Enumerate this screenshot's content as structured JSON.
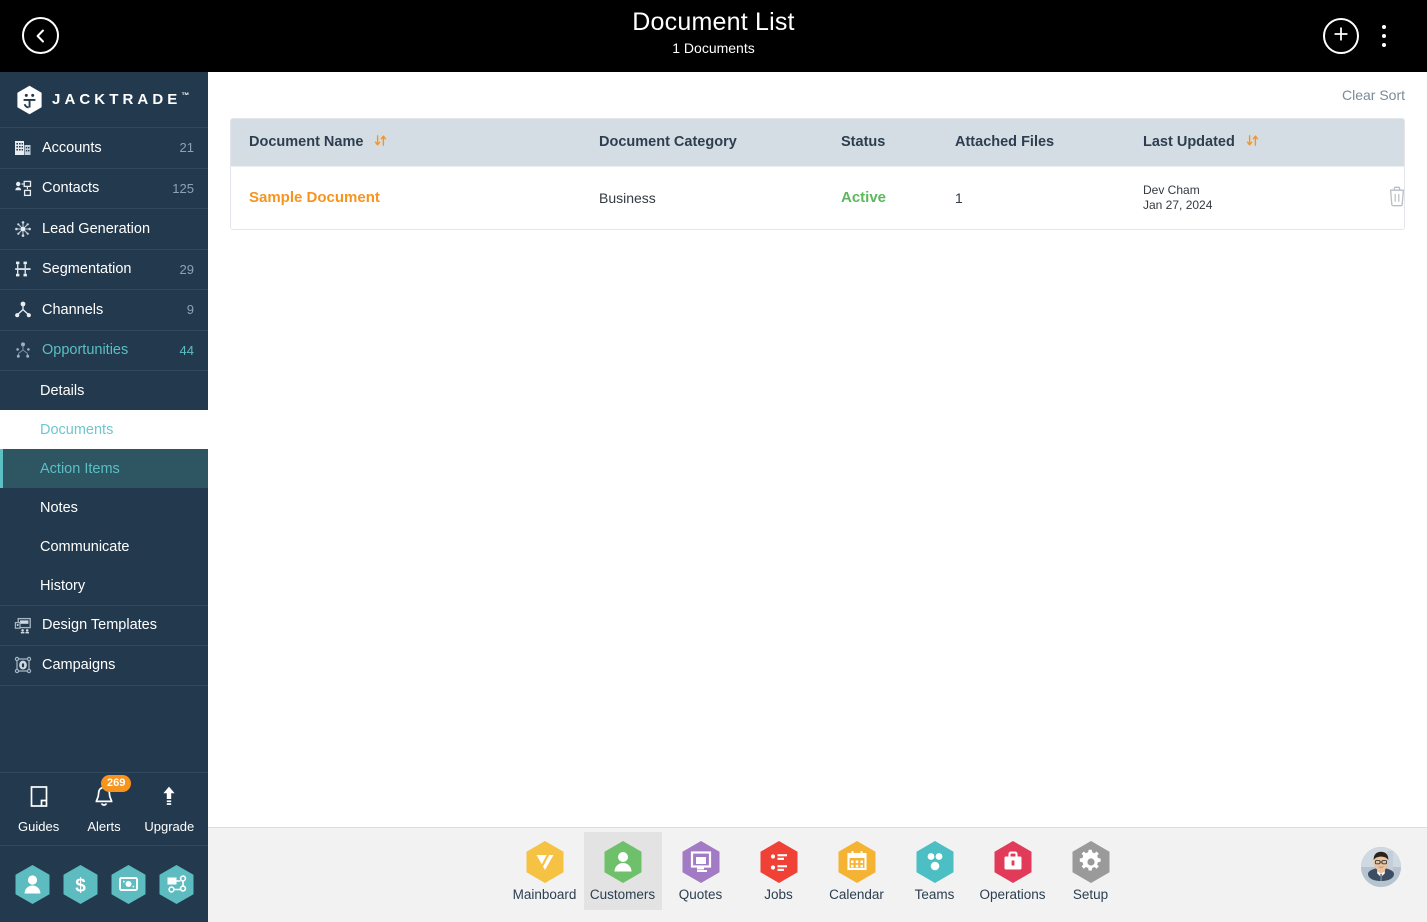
{
  "header": {
    "title": "Document List",
    "subtitle": "1 Documents",
    "back_icon": "chevron-left-icon",
    "add_icon": "plus-icon",
    "menu_icon": "kebab-menu-icon"
  },
  "sidebar": {
    "brand": {
      "name": "JACKTRADE",
      "tm": "™",
      "logo_icon": "jacktrade-hex-logo"
    },
    "items": [
      {
        "label": "Accounts",
        "count": "21",
        "icon": "building-icon",
        "accent": false
      },
      {
        "label": "Contacts",
        "count": "125",
        "icon": "contacts-icon",
        "accent": false
      },
      {
        "label": "Lead Generation",
        "count": "",
        "icon": "lead-generation-icon",
        "accent": false
      },
      {
        "label": "Segmentation",
        "count": "29",
        "icon": "segmentation-icon",
        "accent": false
      },
      {
        "label": "Channels",
        "count": "9",
        "icon": "channels-icon",
        "accent": false
      },
      {
        "label": "Opportunities",
        "count": "44",
        "icon": "opportunities-icon",
        "accent": true
      }
    ],
    "sub_items": [
      {
        "label": "Details",
        "state": "normal"
      },
      {
        "label": "Documents",
        "state": "current"
      },
      {
        "label": "Action Items",
        "state": "hover"
      },
      {
        "label": "Notes",
        "state": "normal"
      },
      {
        "label": "Communicate",
        "state": "normal"
      },
      {
        "label": "History",
        "state": "normal"
      }
    ],
    "items_after": [
      {
        "label": "Design Templates",
        "count": "",
        "icon": "design-templates-icon",
        "accent": false
      },
      {
        "label": "Campaigns",
        "count": "",
        "icon": "campaigns-icon",
        "accent": false
      }
    ],
    "utilities": [
      {
        "label": "Guides",
        "icon": "guides-book-icon",
        "badge": ""
      },
      {
        "label": "Alerts",
        "icon": "bell-icon",
        "badge": "269"
      },
      {
        "label": "Upgrade",
        "icon": "upgrade-arrow-icon",
        "badge": ""
      }
    ],
    "quick_links": [
      {
        "icon": "person-hex-icon"
      },
      {
        "icon": "dollar-hex-icon"
      },
      {
        "icon": "payment-hex-icon"
      },
      {
        "icon": "workflow-hex-icon"
      }
    ],
    "colors": {
      "bg": "#23394e",
      "accent": "#5bbfc4",
      "badge": "#f7941e"
    }
  },
  "main": {
    "clear_sort_label": "Clear Sort",
    "table": {
      "columns": [
        {
          "label": "Document Name",
          "sortable": true
        },
        {
          "label": "Document Category",
          "sortable": false
        },
        {
          "label": "Status",
          "sortable": false
        },
        {
          "label": "Attached Files",
          "sortable": false
        },
        {
          "label": "Last Updated",
          "sortable": true
        },
        {
          "label": "",
          "sortable": false
        }
      ],
      "rows": [
        {
          "name": "Sample Document",
          "category": "Business",
          "status": "Active",
          "attached_files": "1",
          "updated_by": "Dev Cham",
          "updated_date": "Jan 27, 2024",
          "delete_icon": "trash-icon"
        }
      ]
    },
    "colors": {
      "link": "#f7941e",
      "status_active": "#5cb85c",
      "th_bg": "#d4dde3"
    }
  },
  "bottom_nav": {
    "items": [
      {
        "label": "Mainboard",
        "icon": "mainboard-icon",
        "color": "#f5c243",
        "active": false
      },
      {
        "label": "Customers",
        "icon": "customers-icon",
        "color": "#6fc06a",
        "active": true
      },
      {
        "label": "Quotes",
        "icon": "quotes-icon",
        "color": "#a27bc4",
        "active": false
      },
      {
        "label": "Jobs",
        "icon": "jobs-icon",
        "color": "#ef4136",
        "active": false
      },
      {
        "label": "Calendar",
        "icon": "calendar-icon",
        "color": "#f5b333",
        "active": false
      },
      {
        "label": "Teams",
        "icon": "teams-icon",
        "color": "#4bbfc3",
        "active": false
      },
      {
        "label": "Operations",
        "icon": "operations-icon",
        "color": "#e23a59",
        "active": false
      },
      {
        "label": "Setup",
        "icon": "setup-icon",
        "color": "#9a9a9a",
        "active": false
      }
    ],
    "avatar_icon": "user-avatar"
  }
}
